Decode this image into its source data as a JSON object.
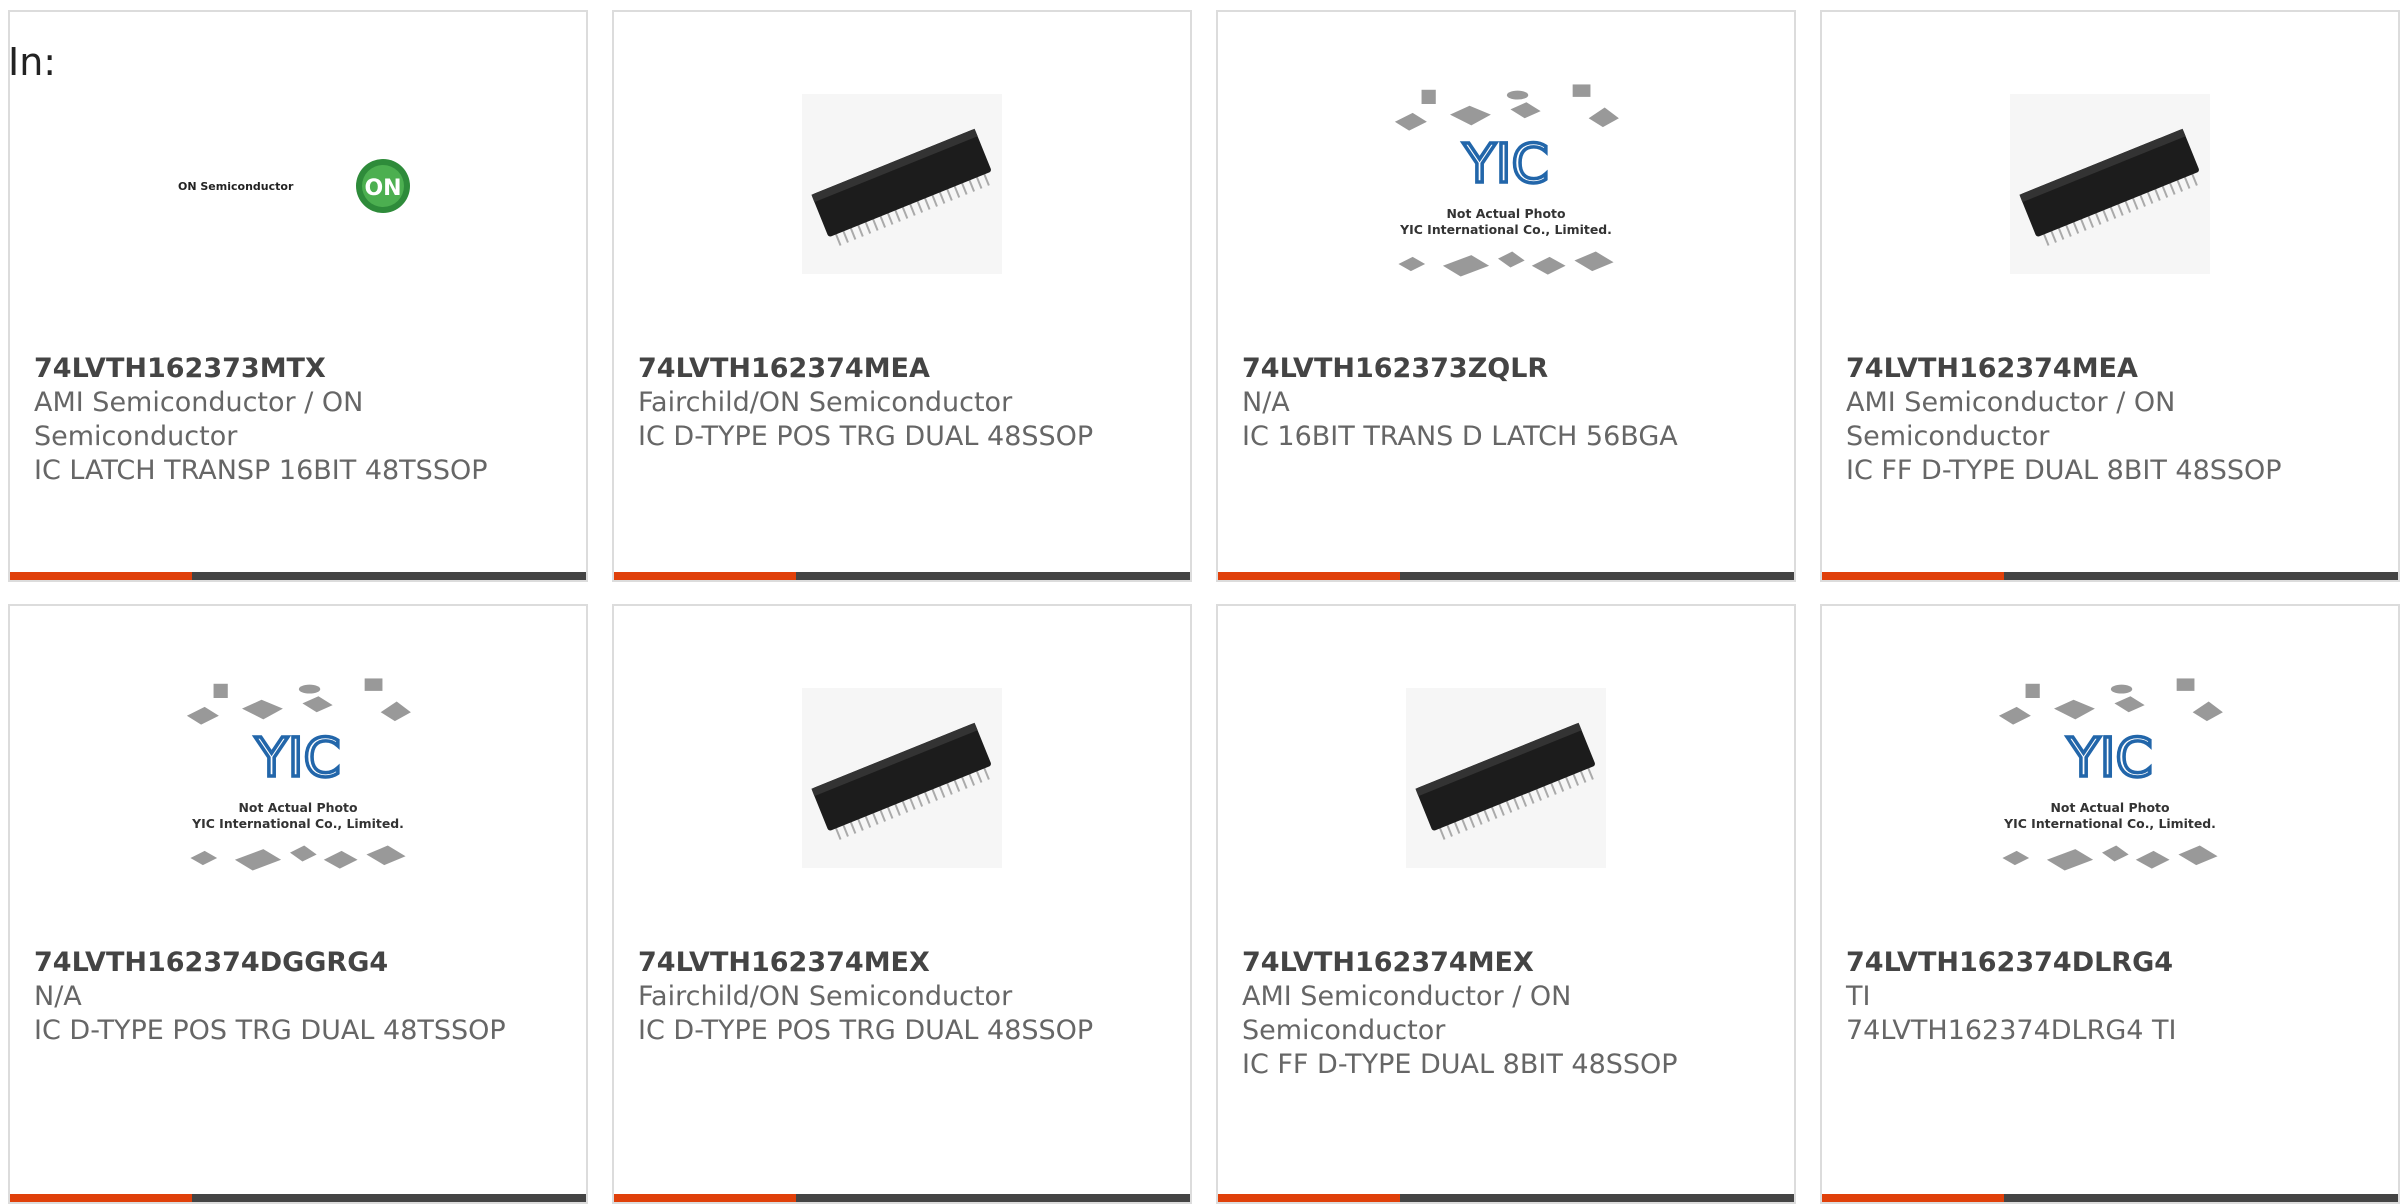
{
  "page": {
    "prefix": "In:"
  },
  "colors": {
    "accent": "#e0400a",
    "bar": "#444444",
    "border": "#dcdcdc",
    "text": "#666666"
  },
  "products": [
    {
      "part": "74LVTH162373MTX",
      "manufacturer": "AMI Semiconductor / ON Semiconductor",
      "description": "IC LATCH TRANSP 16BIT 48TSSOP",
      "image": "on-semiconductor-logo",
      "logo_text": "ON Semiconductor",
      "logo_badge": "ON"
    },
    {
      "part": "74LVTH162374MEA",
      "manufacturer": "Fairchild/ON Semiconductor",
      "description": "IC D-TYPE POS TRG DUAL 48SSOP",
      "image": "ic-chip-photo"
    },
    {
      "part": "74LVTH162373ZQLR",
      "manufacturer": "N/A",
      "description": "IC 16BIT TRANS D LATCH 56BGA",
      "image": "yic-placeholder",
      "placeholder_line1": "Not Actual Photo",
      "placeholder_line2": "YIC International Co., Limited."
    },
    {
      "part": "74LVTH162374MEA",
      "manufacturer": "AMI Semiconductor / ON Semiconductor",
      "description": "IC FF D-TYPE DUAL 8BIT 48SSOP",
      "image": "ic-chip-photo"
    },
    {
      "part": "74LVTH162374DGGRG4",
      "manufacturer": "N/A",
      "description": "IC D-TYPE POS TRG DUAL 48TSSOP",
      "image": "yic-placeholder",
      "placeholder_line1": "Not Actual Photo",
      "placeholder_line2": "YIC International Co., Limited."
    },
    {
      "part": "74LVTH162374MEX",
      "manufacturer": "Fairchild/ON Semiconductor",
      "description": "IC D-TYPE POS TRG DUAL 48SSOP",
      "image": "ic-chip-photo"
    },
    {
      "part": "74LVTH162374MEX",
      "manufacturer": "AMI Semiconductor / ON Semiconductor",
      "description": "IC FF D-TYPE DUAL 8BIT 48SSOP",
      "image": "ic-chip-photo"
    },
    {
      "part": "74LVTH162374DLRG4",
      "manufacturer": "TI",
      "description": "74LVTH162374DLRG4 TI",
      "image": "yic-placeholder",
      "placeholder_line1": "Not Actual Photo",
      "placeholder_line2": "YIC International Co., Limited."
    }
  ]
}
